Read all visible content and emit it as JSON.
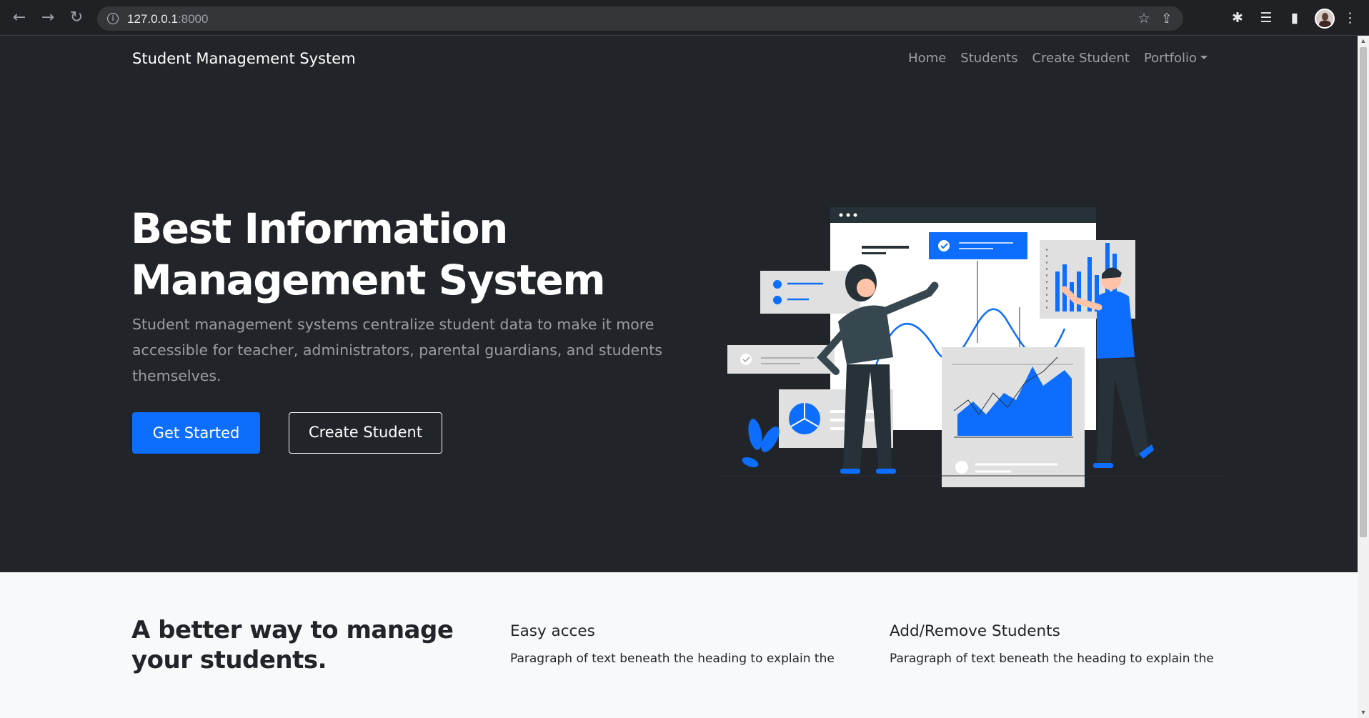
{
  "browser": {
    "url_host": "127.0.0.1",
    "url_port": ":8000"
  },
  "navbar": {
    "brand": "Student Management System",
    "links": [
      "Home",
      "Students",
      "Create Student",
      "Portfolio"
    ]
  },
  "hero": {
    "title_line1": "Best Information",
    "title_line2": "Management System",
    "lead": "Student management systems centralize student data to make it more accessible for teacher, administrators, parental guardians, and students themselves.",
    "primary_button": "Get Started",
    "secondary_button": "Create Student"
  },
  "features": {
    "heading": "A better way to manage your students.",
    "items": [
      {
        "title": "Easy acces",
        "text": "Paragraph of text beneath the heading to explain the"
      },
      {
        "title": "Add/Remove Students",
        "text": "Paragraph of text beneath the heading to explain the"
      }
    ]
  },
  "colors": {
    "hero_bg": "#212529",
    "primary": "#0d6efd",
    "page_bg": "#f8f9fa"
  },
  "icons": [
    "back-icon",
    "forward-icon",
    "reload-icon",
    "info-icon",
    "share-icon",
    "star-icon",
    "extensions-icon",
    "reading-list-icon",
    "side-panel-icon",
    "profile-avatar",
    "menu-icon"
  ]
}
